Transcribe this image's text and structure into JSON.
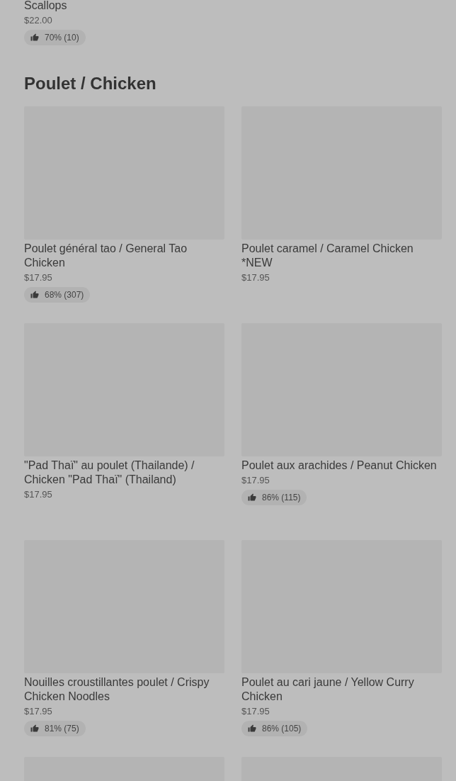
{
  "top_item": {
    "name": "Scallops",
    "price": "$22.00",
    "rating": "70% (10)"
  },
  "section": {
    "title": "Poulet / Chicken",
    "items": [
      {
        "kind": "dish",
        "name": "Poulet général tao / General Tao Chicken",
        "price": "$17.95",
        "rating": "68% (307)"
      },
      {
        "kind": "dish",
        "name": "Poulet caramel / Caramel Chicken *NEW",
        "price": "$17.95"
      },
      {
        "kind": "dish",
        "name": "\"Pad Thaï\" au poulet (Thailande) / Chicken \"Pad Thaï\" (Thailand)",
        "price": "$17.95"
      },
      {
        "kind": "dish",
        "name": "Poulet aux arachides / Peanut Chicken",
        "price": "$17.95",
        "rating": "86% (115)"
      },
      {
        "kind": "dish",
        "name": "Nouilles croustillantes poulet / Crispy Chicken Noodles",
        "price": "$17.95",
        "rating": "81% (75)"
      },
      {
        "kind": "dish",
        "name": "Poulet au cari jaune / Yellow Curry Chicken",
        "price": "$17.95",
        "rating": "86% (105)"
      },
      {
        "kind": "image_only"
      },
      {
        "kind": "image_only"
      }
    ]
  }
}
